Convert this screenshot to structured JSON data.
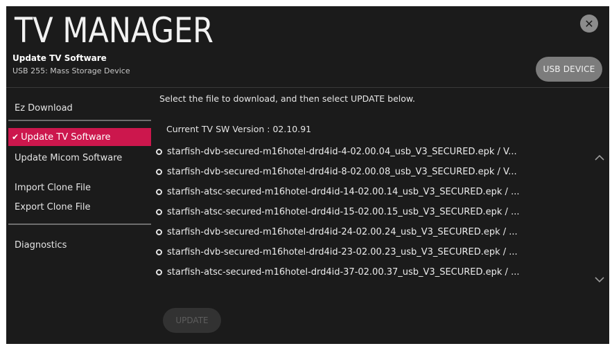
{
  "header": {
    "title": "TV MANAGER",
    "subtitle": "Update TV Software",
    "device": "USB 255: Mass Storage Device",
    "close_icon": "close-icon",
    "usb_button_label": "USB DEVICE"
  },
  "sidebar": {
    "items": [
      {
        "label": "Ez Download",
        "active": false
      },
      {
        "label": "Update TV Software",
        "active": true
      },
      {
        "label": "Update Micom Software",
        "active": false
      },
      {
        "label": "Import Clone File",
        "active": false
      },
      {
        "label": "Export Clone File",
        "active": false
      },
      {
        "label": "Diagnostics",
        "active": false
      }
    ],
    "active_check": "✔"
  },
  "main": {
    "instruction": "Select the file to download, and then select UPDATE below.",
    "current_version": "Current TV SW Version : 02.10.91",
    "files": [
      "starfish-dvb-secured-m16hotel-drd4id-4-02.00.04_usb_V3_SECURED.epk / V...",
      "starfish-dvb-secured-m16hotel-drd4id-8-02.00.08_usb_V3_SECURED.epk / V...",
      "starfish-atsc-secured-m16hotel-drd4id-14-02.00.14_usb_V3_SECURED.epk / ...",
      "starfish-atsc-secured-m16hotel-drd4id-15-02.00.15_usb_V3_SECURED.epk / ...",
      "starfish-dvb-secured-m16hotel-drd4id-24-02.00.24_usb_V3_SECURED.epk / ...",
      "starfish-dvb-secured-m16hotel-drd4id-23-02.00.23_usb_V3_SECURED.epk / ...",
      "starfish-atsc-secured-m16hotel-drd4id-37-02.00.37_usb_V3_SECURED.epk / ..."
    ],
    "update_button_label": "UPDATE"
  },
  "colors": {
    "background": "#1b1b1b",
    "accent": "#cc174d",
    "button": "#7c7c7c"
  }
}
